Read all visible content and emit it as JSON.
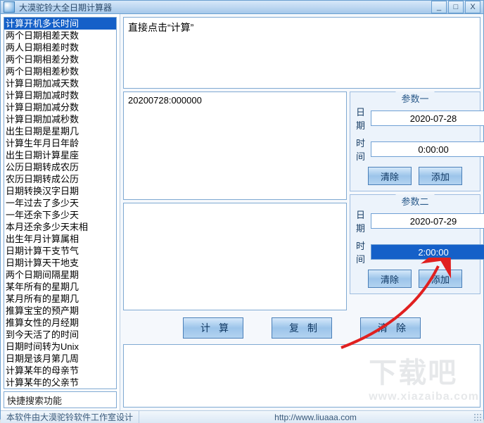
{
  "window": {
    "title": "大漠驼铃大全日期计算器",
    "minimize": "_",
    "maximize": "□",
    "close": "X"
  },
  "sidebar": {
    "items": [
      "计算开机多长时间",
      "两个日期相差天数",
      "两人日期相差时数",
      "两个日期相差分数",
      "两个日期相差秒数",
      "计算日期加减天数",
      "计算日期加减时数",
      "计算日期加减分数",
      "计算日期加减秒数",
      "出生日期是星期几",
      "计算生年月日年龄",
      "出生日期计算星座",
      "公历日期转成农历",
      "农历日期转成公历",
      "日期转换汉字日期",
      "一年过去了多少天",
      "一年还余下多少天",
      "本月还余多少天末相",
      "出生年月计算属相",
      "日期计算干支节气",
      "日期计算天干地支",
      "两个日期间隔星期",
      "某年所有的星期几",
      "某月所有的星期几",
      "推算宝宝的预产期",
      "推算女性的月经期",
      "到今天活了的时间",
      "日期时间转为Unix",
      "日期是该月第几周",
      "计算某年的母亲节",
      "计算某年的父亲节"
    ],
    "selected_index": 0,
    "quick_search_hint": "快捷搜索功能"
  },
  "info_text": "直接点击“计算”",
  "log_top": "20200728:000000",
  "log_bottom": "",
  "params": {
    "group1": {
      "title": "参数一",
      "date_label": "日期",
      "date_value": "2020-07-28",
      "time_label": "时间",
      "time_value": "0:00:00",
      "clear": "清除",
      "add": "添加"
    },
    "group2": {
      "title": "参数二",
      "date_label": "日期",
      "date_value": "2020-07-29",
      "time_label": "时间",
      "time_value": "2:00:00",
      "clear": "清除",
      "add": "添加"
    }
  },
  "buttons": {
    "calc": "计算",
    "copy": "复制",
    "clear": "清除"
  },
  "statusbar": {
    "credit": "本软件由大漠驼铃软件工作室设计",
    "url": "http://www.liuaaa.com"
  },
  "watermark": {
    "big": "下载吧",
    "small": "www.xiazaiba.com"
  }
}
